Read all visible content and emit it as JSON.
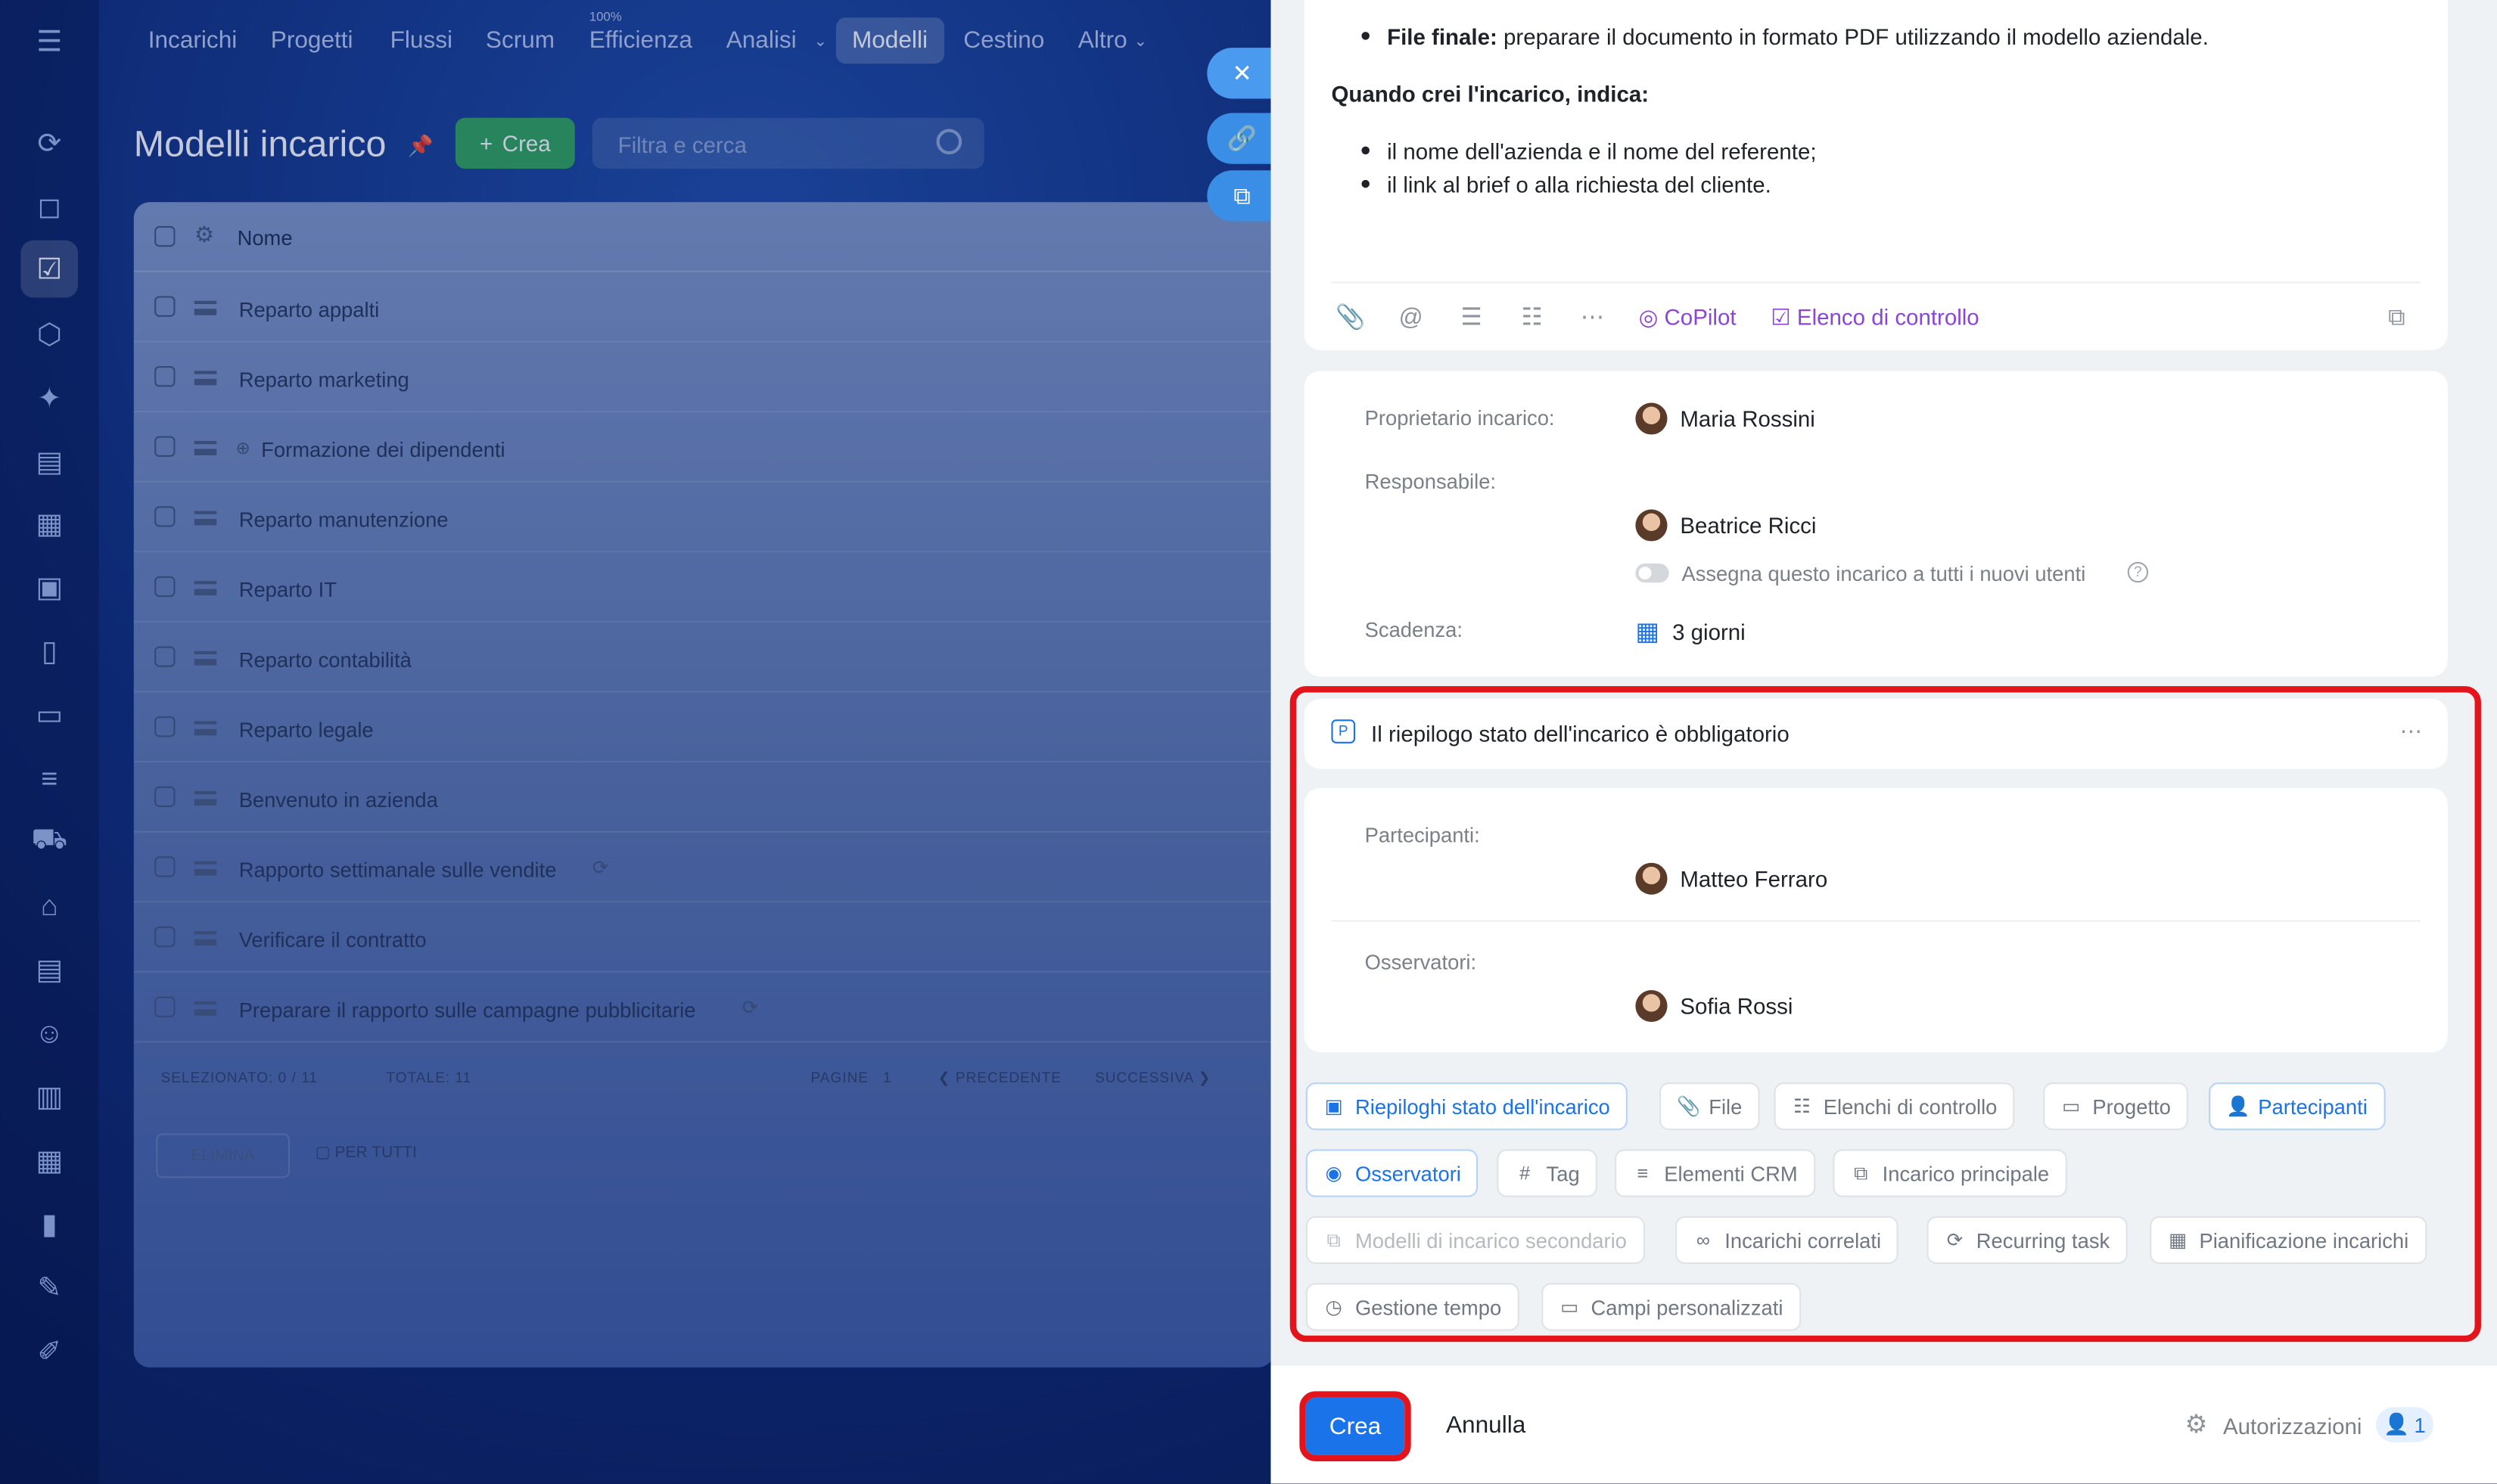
{
  "nav": {
    "items": [
      "Incarichi",
      "Progetti",
      "Flussi",
      "Scrum",
      "Efficienza",
      "Analisi",
      "Modelli",
      "Cestino",
      "Altro"
    ],
    "efficienza_badge": "100%",
    "selected": "Modelli"
  },
  "page": {
    "title": "Modelli incarico",
    "create_label": "Crea",
    "filter_placeholder": "Filtra e cerca"
  },
  "list": {
    "column_name": "Nome",
    "rows": [
      "Reparto appalti",
      "Reparto marketing",
      "Formazione dei dipendenti",
      "Reparto manutenzione",
      "Reparto IT",
      "Reparto contabilità",
      "Reparto legale",
      "Benvenuto in azienda",
      "Rapporto settimanale sulle vendite",
      "Verificare il contratto",
      "Preparare il rapporto sulle campagne pubblicitarie"
    ],
    "footer": {
      "selected_label": "SELEZIONATO:",
      "selected_value": "0 / 11",
      "total_label": "TOTALE:",
      "total_value": "11",
      "pages_label": "PAGINE",
      "pages_value": "1",
      "prev": "PRECEDENTE",
      "next": "SUCCESSIVA",
      "delete": "ELIMINA",
      "for_all": "PER TUTTI"
    }
  },
  "panel": {
    "desc": {
      "line1_bold": "File finale:",
      "line1_rest": "preparare il documento in formato PDF utilizzando il modello aziendale.",
      "heading": "Quando crei l'incarico, indica:",
      "bullet1": "il nome dell'azienda e il nome del referente;",
      "bullet2": "il link al brief o alla richiesta del cliente."
    },
    "toolbar": {
      "copilot": "CoPilot",
      "checklist": "Elenco di controllo"
    },
    "owner_label": "Proprietario incarico:",
    "owner": "Maria Rossini",
    "responsible_label": "Responsabile:",
    "responsible": "Beatrice Ricci",
    "assign_all": "Assegna questo incarico a tutti i nuovi utenti",
    "deadline_label": "Scadenza:",
    "deadline": "3 giorni",
    "summary_title": "Il riepilogo stato dell'incarico è obbligatorio",
    "participants_label": "Partecipanti:",
    "participant": "Matteo Ferraro",
    "observers_label": "Osservatori:",
    "observer": "Sofia Rossi",
    "chips": {
      "c1": "Riepiloghi stato dell'incarico",
      "c2": "File",
      "c3": "Elenchi di controllo",
      "c4": "Progetto",
      "c5": "Partecipanti",
      "c6": "Osservatori",
      "c7": "Tag",
      "c8": "Elementi CRM",
      "c9": "Incarico principale",
      "c10": "Modelli di incarico secondario",
      "c11": "Incarichi correlati",
      "c12": "Recurring task",
      "c13": "Pianificazione incarichi",
      "c14": "Gestione tempo",
      "c15": "Campi personalizzati"
    },
    "footer": {
      "create": "Crea",
      "cancel": "Annulla",
      "permissions": "Autorizzazioni",
      "permissions_count": "1"
    }
  },
  "colors": {
    "accent": "#1a73e8",
    "green": "#2fa35a",
    "highlight": "#e3141b",
    "copilot": "#8c45d6"
  }
}
